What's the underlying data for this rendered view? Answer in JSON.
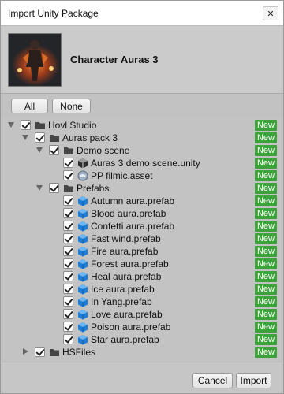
{
  "window": {
    "title": "Import Unity Package",
    "close_glyph": "✕"
  },
  "package": {
    "title": "Character Auras 3",
    "thumbnail_icon": "package-preview-image"
  },
  "selection": {
    "all_label": "All",
    "none_label": "None"
  },
  "tree": {
    "badge_color": "#3ba33a",
    "items": [
      {
        "label": "Hovl Studio",
        "type": "folder",
        "depth": 0,
        "expanded": true,
        "checked": true,
        "badge": "New"
      },
      {
        "label": "Auras pack 3",
        "type": "folder",
        "depth": 1,
        "expanded": true,
        "checked": true,
        "badge": "New"
      },
      {
        "label": "Demo scene",
        "type": "folder",
        "depth": 2,
        "expanded": true,
        "checked": true,
        "badge": "New"
      },
      {
        "label": "Auras 3 demo scene.unity",
        "type": "scene",
        "depth": 3,
        "checked": true,
        "badge": "New"
      },
      {
        "label": "PP filmic.asset",
        "type": "asset",
        "depth": 3,
        "checked": true,
        "badge": "New"
      },
      {
        "label": "Prefabs",
        "type": "folder",
        "depth": 2,
        "expanded": true,
        "checked": true,
        "badge": "New"
      },
      {
        "label": "Autumn aura.prefab",
        "type": "prefab",
        "depth": 3,
        "checked": true,
        "badge": "New"
      },
      {
        "label": "Blood aura.prefab",
        "type": "prefab",
        "depth": 3,
        "checked": true,
        "badge": "New"
      },
      {
        "label": "Confetti aura.prefab",
        "type": "prefab",
        "depth": 3,
        "checked": true,
        "badge": "New"
      },
      {
        "label": "Fast wind.prefab",
        "type": "prefab",
        "depth": 3,
        "checked": true,
        "badge": "New"
      },
      {
        "label": "Fire aura.prefab",
        "type": "prefab",
        "depth": 3,
        "checked": true,
        "badge": "New"
      },
      {
        "label": "Forest aura.prefab",
        "type": "prefab",
        "depth": 3,
        "checked": true,
        "badge": "New"
      },
      {
        "label": "Heal aura.prefab",
        "type": "prefab",
        "depth": 3,
        "checked": true,
        "badge": "New"
      },
      {
        "label": "Ice aura.prefab",
        "type": "prefab",
        "depth": 3,
        "checked": true,
        "badge": "New"
      },
      {
        "label": "In Yang.prefab",
        "type": "prefab",
        "depth": 3,
        "checked": true,
        "badge": "New"
      },
      {
        "label": "Love aura.prefab",
        "type": "prefab",
        "depth": 3,
        "checked": true,
        "badge": "New"
      },
      {
        "label": "Poison aura.prefab",
        "type": "prefab",
        "depth": 3,
        "checked": true,
        "badge": "New"
      },
      {
        "label": "Star aura.prefab",
        "type": "prefab",
        "depth": 3,
        "checked": true,
        "badge": "New"
      },
      {
        "label": "HSFiles",
        "type": "folder",
        "depth": 1,
        "expanded": false,
        "checked": true,
        "badge": "New"
      }
    ]
  },
  "footer": {
    "cancel_label": "Cancel",
    "import_label": "Import"
  }
}
